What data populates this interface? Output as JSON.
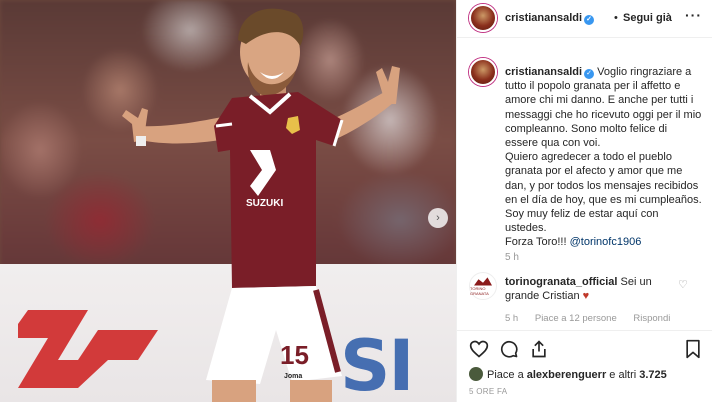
{
  "post": {
    "username": "cristianansaldi",
    "follow_label": "Segui già",
    "separator": "•",
    "more_icon": "more-horizontal-icon"
  },
  "caption": {
    "username": "cristianansaldi",
    "text_it": " Voglio ringraziare a tutto il popolo granata per il affetto e amore chi mi danno. E anche per tutti i messaggi che ho ricevuto oggi per il mio compleanno. Sono molto felice di essere qua con voi.",
    "text_es": "Quiero agredecer a todo el pueblo granata por el afecto y amor que me dan, y por todos los mensajes recibidos en el día de hoy, que es mi cumpleaños. Soy muy feliz de estar aquí con ustedes.",
    "text_end": "Forza Toro!!! ",
    "mention": "@torinofc1906",
    "time": "5 h"
  },
  "comment": {
    "username": "torinogranata_official",
    "text": " Sei un grande Cristian ",
    "heart_emoji": "♥",
    "avatar_text": "TORINO GRANATA",
    "time": "5 h",
    "likes": "Piace a 12 persone",
    "reply": "Rispondi"
  },
  "actions": {
    "likes_prefix": "Piace a ",
    "liked_by": "alexberenguerr",
    "likes_suffix": " e altri ",
    "likes_count": "3.725",
    "timestamp": "5 ORE FA"
  },
  "photo": {
    "jersey_number": "15",
    "jersey_sponsor": "SUZUKI",
    "shorts_brand": "Joma",
    "board_text": "SI"
  },
  "colors": {
    "accent_blue": "#3897f0",
    "granata": "#7a1e28",
    "heart_red": "#ed4956"
  }
}
